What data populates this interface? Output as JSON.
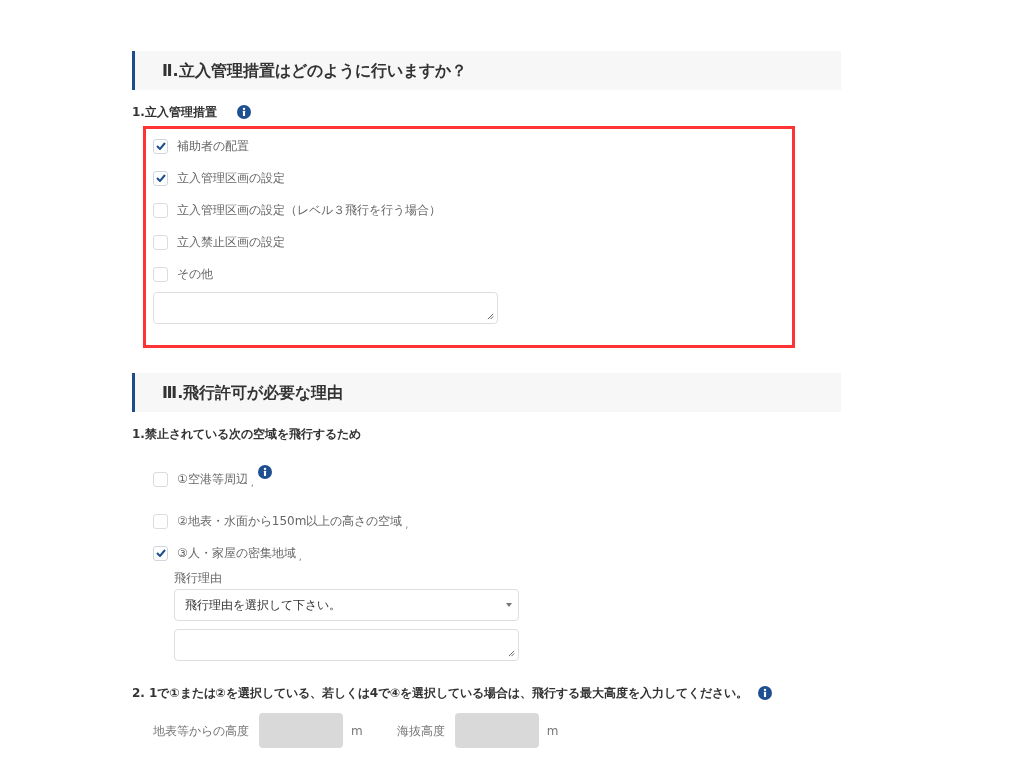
{
  "sections": [
    {
      "title": "Ⅱ.立入管理措置はどのように行いますか？",
      "questions": [
        {
          "label": "1.立入管理措置",
          "info": true,
          "highlighted": true,
          "items": [
            {
              "kind": "checkbox",
              "label": "補助者の配置",
              "checked": true
            },
            {
              "kind": "checkbox",
              "label": "立入管理区画の設定",
              "checked": true
            },
            {
              "kind": "checkbox",
              "label": "立入管理区画の設定（レベル３飛行を行う場合）",
              "checked": false
            },
            {
              "kind": "checkbox",
              "label": "立入禁止区画の設定",
              "checked": false
            },
            {
              "kind": "checkbox",
              "label": "その他",
              "checked": false
            },
            {
              "kind": "textarea"
            }
          ]
        }
      ]
    },
    {
      "title": "Ⅲ.飛行許可が必要な理由",
      "questions": [
        {
          "label": "1.禁止されている次の空域を飛行するため",
          "items": [
            {
              "kind": "checkbox",
              "label": "①空港等周辺",
              "suffix": ",",
              "info": true,
              "checked": false
            },
            {
              "kind": "checkbox",
              "label": "②地表・水面から150m以上の高さの空域",
              "suffix": ",",
              "checked": false
            },
            {
              "kind": "checkbox",
              "label": "③人・家屋の密集地域",
              "suffix": ",",
              "checked": true,
              "children": [
                {
                  "kind": "caption",
                  "label": "飛行理由"
                },
                {
                  "kind": "select",
                  "value": "飛行理由を選択して下さい。"
                },
                {
                  "kind": "textarea"
                }
              ]
            }
          ]
        },
        {
          "label": "2. 1で①または②を選択している、若しくは4で④を選択している場合は、飛行する最大高度を入力してください。",
          "info": true,
          "items": [
            {
              "kind": "heights",
              "fields": [
                {
                  "label": "地表等からの高度",
                  "unit": "m",
                  "disabled": true
                },
                {
                  "label": "海抜高度",
                  "unit": "m",
                  "disabled": true
                }
              ]
            }
          ]
        }
      ]
    }
  ]
}
